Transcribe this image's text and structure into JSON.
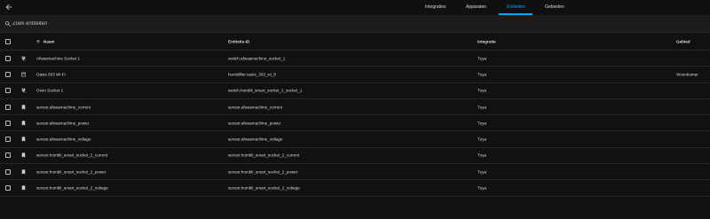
{
  "search": {
    "placeholder": "Zoek entiteiten"
  },
  "tabs": [
    {
      "label": "Integraties",
      "active": false
    },
    {
      "label": "Apparaten",
      "active": false
    },
    {
      "label": "Entiteiten",
      "active": true
    },
    {
      "label": "Gebieden",
      "active": false
    }
  ],
  "columns": {
    "name": "Naam",
    "entity_id": "Entiteits-ID",
    "integration": "Integratie",
    "area": "Gebied"
  },
  "rows": [
    {
      "icon": "power-plug-off-icon",
      "name": "Afwasmachine Socket 1",
      "entity_id": "switch.afwasmachine_socket_1",
      "integration": "Tuya",
      "area": ""
    },
    {
      "icon": "air-humidifier-icon",
      "name": "Oasis 303 Wi-Fi",
      "entity_id": "humidifier.oasis_303_wi_fi",
      "integration": "Tuya",
      "area": "Woonkamer"
    },
    {
      "icon": "power-plug-off-icon",
      "name": "Oven Socket 1",
      "entity_id": "switch.hombli_smart_socket_2_socket_1",
      "integration": "Tuya",
      "area": ""
    },
    {
      "icon": "bookmark-icon",
      "name": "sensor.afwasmachine_current",
      "entity_id": "sensor.afwasmachine_current",
      "integration": "Tuya",
      "area": ""
    },
    {
      "icon": "bookmark-icon",
      "name": "sensor.afwasmachine_power",
      "entity_id": "sensor.afwasmachine_power",
      "integration": "Tuya",
      "area": ""
    },
    {
      "icon": "bookmark-icon",
      "name": "sensor.afwasmachine_voltage",
      "entity_id": "sensor.afwasmachine_voltage",
      "integration": "Tuya",
      "area": ""
    },
    {
      "icon": "bookmark-icon",
      "name": "sensor.hombli_smart_socket_2_current",
      "entity_id": "sensor.hombli_smart_socket_2_current",
      "integration": "Tuya",
      "area": ""
    },
    {
      "icon": "bookmark-icon",
      "name": "sensor.hombli_smart_socket_2_power",
      "entity_id": "sensor.hombli_smart_socket_2_power",
      "integration": "Tuya",
      "area": ""
    },
    {
      "icon": "bookmark-icon",
      "name": "sensor.hombli_smart_socket_2_voltage",
      "entity_id": "sensor.hombli_smart_socket_2_voltage",
      "integration": "Tuya",
      "area": ""
    }
  ],
  "colors": {
    "accent": "#03a9f4",
    "background": "#111111",
    "text": "#e1e1e1"
  }
}
